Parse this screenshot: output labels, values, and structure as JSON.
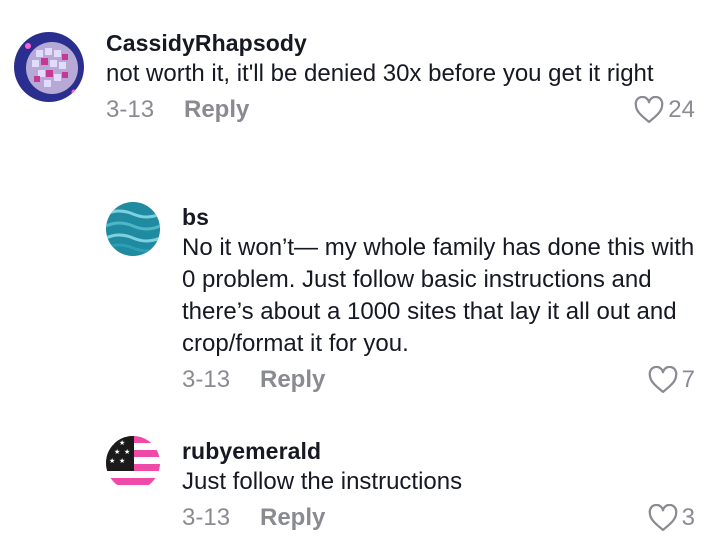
{
  "comments": [
    {
      "username": "CassidyRhapsody",
      "text": "not worth it, it'll be denied 30x before you get it right",
      "date": "3-13",
      "reply_label": "Reply",
      "likes": "24"
    },
    {
      "username": "bs",
      "text": "No it won’t— my whole family has done this with 0 problem. Just follow basic instructions and there’s about a 1000 sites that lay it all out and crop/format it for you.",
      "date": "3-13",
      "reply_label": "Reply",
      "likes": "7"
    },
    {
      "username": "rubyemerald",
      "text": "Just follow the instructions",
      "date": "3-13",
      "reply_label": "Reply",
      "likes": "3"
    }
  ],
  "colors": {
    "text": "#161823",
    "muted": "#8a8b91",
    "background": "#ffffff"
  },
  "icons": [
    "disco-ball-avatar",
    "water-avatar",
    "pink-flag-avatar",
    "heart-icon"
  ]
}
